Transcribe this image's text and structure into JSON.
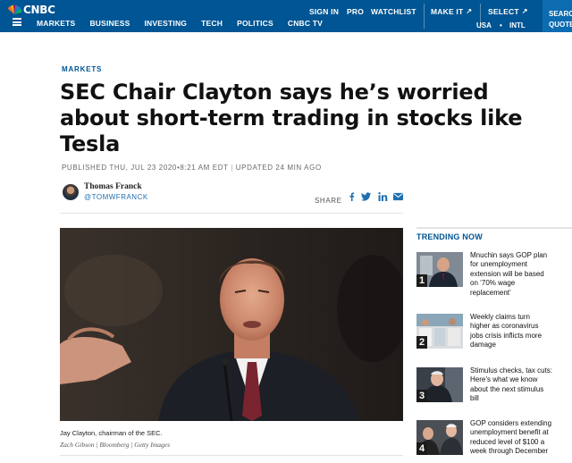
{
  "brand": {
    "logo_text": "CNBC",
    "primary_color": "#005594"
  },
  "nav": {
    "sections": [
      "MARKETS",
      "BUSINESS",
      "INVESTING",
      "TECH",
      "POLITICS",
      "CNBC TV"
    ],
    "sign_in": "SIGN IN",
    "pro": "PRO",
    "watchlist": "WATCHLIST",
    "make_it": "MAKE IT",
    "select": "SELECT",
    "region_usa": "USA",
    "region_dot": "•",
    "region_intl": "INTL",
    "search": "SEARCH",
    "quote": "QUOTE",
    "external_icon": "↗"
  },
  "article": {
    "section": "MARKETS",
    "headline_lines": [
      "SEC Chair Clayton says he’s worried",
      "about short-term trading in stocks like",
      "Tesla"
    ],
    "published": "PUBLISHED THU, JUL 23 2020•8:21 AM EDT",
    "published_sep": "|",
    "updated": "UPDATED 24 MIN AGO",
    "author_name": "Thomas Franck",
    "author_handle": "@TOMWFRANCK",
    "share_label": "SHARE",
    "share_icons": [
      "facebook-icon",
      "twitter-icon",
      "linkedin-icon",
      "email-icon"
    ],
    "caption": "Jay Clayton, chairman of the SEC.",
    "credit": "Zach Gibson | Bloomberg | Getty Images"
  },
  "trending": {
    "title": "TRENDING NOW",
    "items": [
      {
        "num": "1",
        "lines": [
          "Mnuchin says GOP plan",
          "for unemployment",
          "extension will be based",
          "on ‘70% wage",
          "replacement’"
        ]
      },
      {
        "num": "2",
        "lines": [
          "Weekly claims turn",
          "higher as coronavirus",
          "jobs crisis inflicts more",
          "damage"
        ]
      },
      {
        "num": "3",
        "lines": [
          "Stimulus checks, tax cuts:",
          "Here’s what we know",
          "about the next stimulus",
          "bill"
        ]
      },
      {
        "num": "4",
        "lines": [
          "GOP considers extending",
          "unemployment benefit at",
          "reduced level of $100 a",
          "week through December"
        ]
      }
    ]
  }
}
